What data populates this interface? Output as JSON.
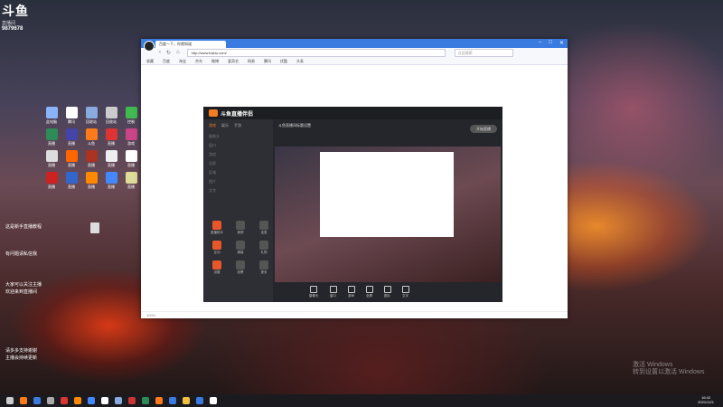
{
  "logo": {
    "mark": "斗鱼",
    "sub": "直播间",
    "room": "9879678"
  },
  "desktop": {
    "icons": [
      {
        "label": "此电脑",
        "color": "#8ab4f8"
      },
      {
        "label": "腾讯",
        "color": "#ffffff"
      },
      {
        "label": "回收站",
        "color": "#88aadd"
      },
      {
        "label": "回收站",
        "color": "#cccccc"
      },
      {
        "label": "控制",
        "color": "#3fb950"
      },
      {
        "label": "直播",
        "color": "#2e8b57"
      },
      {
        "label": "直播",
        "color": "#4444aa"
      },
      {
        "label": "斗鱼",
        "color": "#ff7a1a"
      },
      {
        "label": "直播",
        "color": "#dd3333"
      },
      {
        "label": "游戏",
        "color": "#cc4488"
      },
      {
        "label": "直播",
        "color": "#dddddd"
      },
      {
        "label": "直播",
        "color": "#ff6600"
      },
      {
        "label": "直播",
        "color": "#aa3322"
      },
      {
        "label": "直播",
        "color": "#eeeeee"
      },
      {
        "label": "直播",
        "color": "#ffffff"
      },
      {
        "label": "直播",
        "color": "#cc2222"
      },
      {
        "label": "直播",
        "color": "#3366cc"
      },
      {
        "label": "直播",
        "color": "#ff8800"
      },
      {
        "label": "直播",
        "color": "#4488ff"
      },
      {
        "label": "直播",
        "color": "#dddd99"
      }
    ]
  },
  "notes": [
    "这是新手直播教程",
    "有问题请私信我",
    "大家可以关注主播",
    "欢迎来到直播间",
    "请多多支持谢谢",
    "主播会持续更新"
  ],
  "browser": {
    "tab_title": "百度一下，你就知道",
    "url": "http://www.baidu.com/",
    "search_placeholder": "点此搜索",
    "bookmarks": [
      "收藏",
      "百度",
      "淘宝",
      "京东",
      "微博",
      "爱奇艺",
      "网易",
      "腾讯",
      "优酷",
      "头条"
    ],
    "status": "100%"
  },
  "app": {
    "title": "斗鱼直播伴侣",
    "tabs": [
      "游戏",
      "娱乐",
      "手游"
    ],
    "side_items": [
      "摄像头",
      "窗口",
      "游戏",
      "全屏",
      "区域",
      "图片",
      "文字"
    ],
    "tools": [
      "直播助手",
      "美颜",
      "连麦",
      "互动",
      "弹幕",
      "礼物",
      "设置",
      "投票",
      "更多"
    ],
    "stream_title": "斗鱼直播间标题设置",
    "bottom": [
      "摄像头",
      "窗口",
      "游戏",
      "全屏",
      "图片",
      "文字"
    ],
    "go_live": "开始直播"
  },
  "clock": {
    "time": "16:42",
    "date": "2021/12/1"
  },
  "watermark": [
    "激活 Windows",
    "转到设置以激活 Windows"
  ]
}
